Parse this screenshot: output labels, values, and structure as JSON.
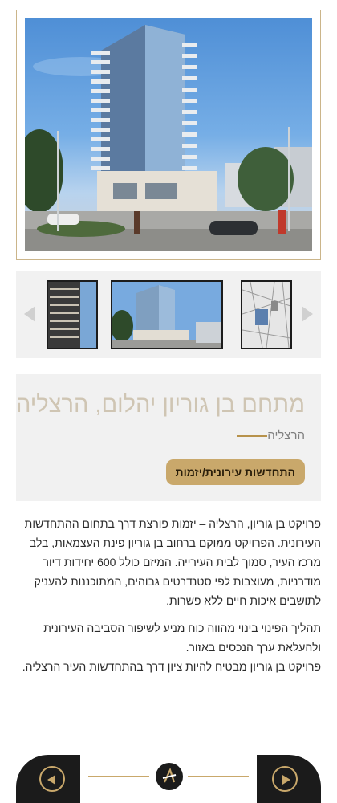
{
  "project": {
    "title": "מתחם בן גוריון יהלום, הרצליה",
    "city": "הרצליה",
    "category_label": "התחדשות עירונית/יזמות"
  },
  "description": {
    "paragraph1": "פרויקט בן גוריון, הרצליה – יזמות פורצת דרך בתחום ההתחדשות העירונית. הפרויקט ממוקם ברחוב בן גוריון פינת העצמאות, בלב מרכז העיר, סמוך לבית העירייה. המיזם כולל 600 יחידות דיור מודרניות, מעוצבות לפי סטנדרטים גבוהים, המתוכננות להעניק לתושבים איכות חיים ללא פשרות.",
    "paragraph2": "תהליך הפינוי בינוי מהווה כוח מניע לשיפור הסביבה העירונית ולהעלאת ערך הנכסים באזור.",
    "paragraph3": "פרויקט בן גוריון מבטיח להיות ציון דרך בהתחדשות העיר הרצליה."
  },
  "colors": {
    "accent_gold": "#c9a86b",
    "dark": "#1b1b1b",
    "panel_gray": "#f1f1f1"
  },
  "icons": {
    "gallery_prev": "triangle-left-icon",
    "gallery_next": "triangle-right-icon",
    "nav_prev": "circle-arrow-left-icon",
    "nav_next": "circle-arrow-right-icon",
    "logo": "brand-logo-icon"
  }
}
